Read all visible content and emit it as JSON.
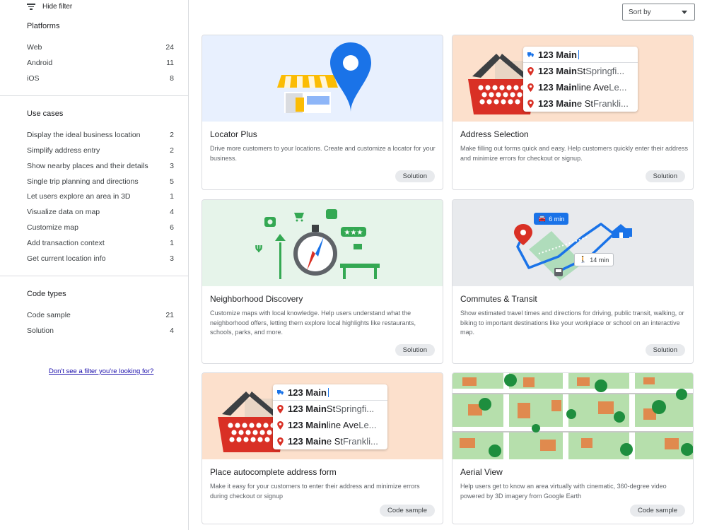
{
  "sidebar": {
    "hide_filter": "Hide filter",
    "platforms": {
      "title": "Platforms",
      "items": [
        {
          "label": "Web",
          "count": "24"
        },
        {
          "label": "Android",
          "count": "11"
        },
        {
          "label": "iOS",
          "count": "8"
        }
      ]
    },
    "use_cases": {
      "title": "Use cases",
      "items": [
        {
          "label": "Display the ideal business location",
          "count": "2"
        },
        {
          "label": "Simplify address entry",
          "count": "2"
        },
        {
          "label": "Show nearby places and their details",
          "count": "3"
        },
        {
          "label": "Single trip planning and directions",
          "count": "5"
        },
        {
          "label": "Let users explore an area in 3D",
          "count": "1"
        },
        {
          "label": "Visualize data on map",
          "count": "4"
        },
        {
          "label": "Customize map",
          "count": "6"
        },
        {
          "label": "Add transaction context",
          "count": "1"
        },
        {
          "label": "Get current location info",
          "count": "3"
        }
      ]
    },
    "code_types": {
      "title": "Code types",
      "items": [
        {
          "label": "Code sample",
          "count": "21"
        },
        {
          "label": "Solution",
          "count": "4"
        }
      ]
    },
    "missing_filter_link": "Don't see a filter you're looking for?"
  },
  "sort": {
    "label": "Sort by"
  },
  "address_mock": {
    "input": "123 Main",
    "suggestions": [
      {
        "bold": "123 Main",
        "normal": " St",
        "rest": " Springfi..."
      },
      {
        "bold": "123 Main",
        "normal": "line Ave",
        "rest": " Le..."
      },
      {
        "bold": "123 Main",
        "normal": "e St",
        "rest": " Frankli..."
      }
    ]
  },
  "commute": {
    "drive_time": "6 min",
    "walk_time": "14 min"
  },
  "cards": [
    {
      "title": "Locator Plus",
      "desc": "Drive more customers to your locations. Create and customize a locator for your business.",
      "tag": "Solution"
    },
    {
      "title": "Address Selection",
      "desc": "Make filling out forms quick and easy. Help customers quickly enter their address and minimize errors for checkout or signup.",
      "tag": "Solution"
    },
    {
      "title": "Neighborhood Discovery",
      "desc": "Customize maps with local knowledge. Help users understand what the neighborhood offers, letting them explore local highlights like restaurants, schools, parks, and more.",
      "tag": "Solution"
    },
    {
      "title": "Commutes & Transit",
      "desc": "Show estimated travel times and directions for driving, public transit, walking, or biking to important destinations like your workplace or school on an interactive map.",
      "tag": "Solution"
    },
    {
      "title": "Place autocomplete address form",
      "desc": "Make it easy for your customers to enter their address and minimize errors during checkout or signup",
      "tag": "Code sample"
    },
    {
      "title": "Aerial View",
      "desc": "Help users get to know an area virtually with cinematic, 360-degree video powered by 3D imagery from Google Earth",
      "tag": "Code sample"
    }
  ],
  "colors": {
    "accent": "#1a73e8",
    "pin_red": "#d93025",
    "basket_red": "#d93025"
  }
}
